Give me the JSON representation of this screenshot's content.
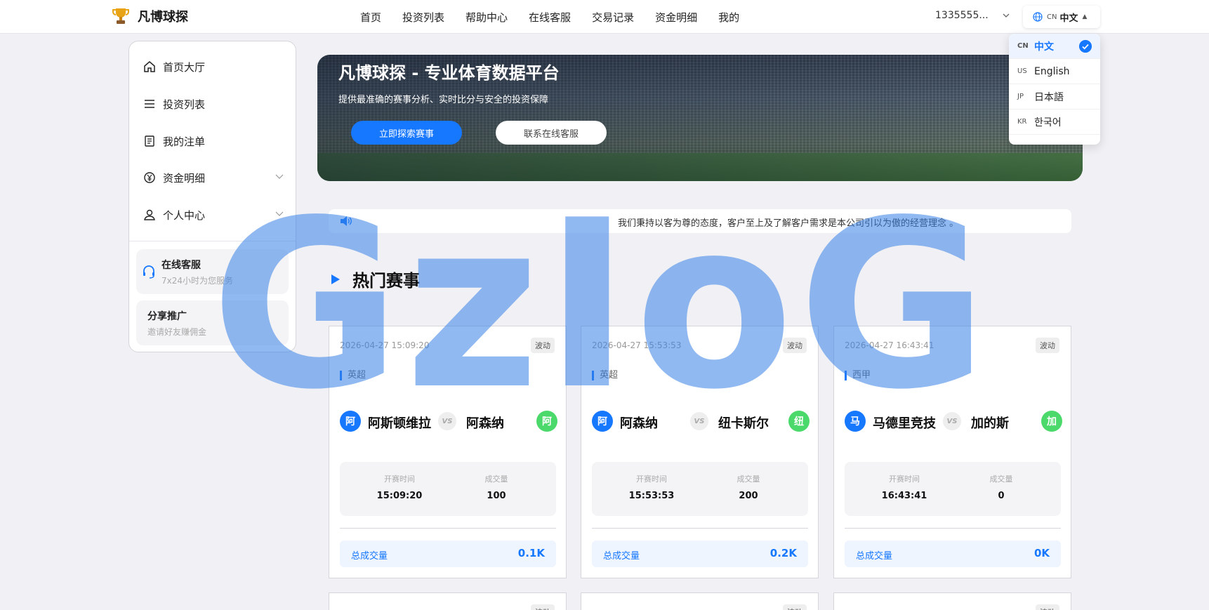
{
  "header": {
    "brand_name": "凡博球探",
    "nav": [
      "首页",
      "投资列表",
      "帮助中心",
      "在线客服",
      "交易记录",
      "资金明细",
      "我的"
    ],
    "account": "1335555...",
    "language": {
      "code": "CN",
      "label": "中文"
    }
  },
  "language_menu": [
    {
      "code": "CN",
      "label": "中文",
      "selected": true
    },
    {
      "code": "US",
      "label": "English",
      "selected": false
    },
    {
      "code": "JP",
      "label": "日本語",
      "selected": false
    },
    {
      "code": "KR",
      "label": "한국어",
      "selected": false
    }
  ],
  "sidebar": {
    "items": [
      {
        "label": "首页大厅",
        "icon": "home-icon"
      },
      {
        "label": "投资列表",
        "icon": "list-icon"
      },
      {
        "label": "我的注单",
        "icon": "document-icon"
      },
      {
        "label": "资金明细",
        "icon": "yen-coin-icon",
        "expandable": true
      },
      {
        "label": "个人中心",
        "icon": "user-icon",
        "expandable": true
      }
    ],
    "support": {
      "title": "在线客服",
      "subtitle": "7x24小时为您服务"
    },
    "share": {
      "title": "分享推广",
      "subtitle": "邀请好友赚佣金"
    }
  },
  "banner": {
    "title": "凡博球探 - 专业体育数据平台",
    "subtitle": "提供最准确的赛事分析、实时比分与安全的投资保障",
    "primary_button": "立即探索赛事",
    "secondary_button": "联系在线客服"
  },
  "notice": "我们秉持以客为尊的态度，客户至上及了解客户需求是本公司引以为傲的经营理念 。",
  "section_title": "热门赛事",
  "labels": {
    "status": "波动",
    "vs": "VS",
    "start_time": "开赛时间",
    "volume": "成交量",
    "total_volume": "总成交量"
  },
  "matches": [
    {
      "datetime": "2026-04-27 15:09:20",
      "league": "英超",
      "home": "阿斯顿维拉",
      "home_initial": "阿",
      "away": "阿森纳",
      "away_initial": "阿",
      "start_time": "15:09:20",
      "volume": "100",
      "total": "0.1K"
    },
    {
      "datetime": "2026-04-27 15:53:53",
      "league": "英超",
      "home": "阿森纳",
      "home_initial": "阿",
      "away": "纽卡斯尔",
      "away_initial": "纽",
      "start_time": "15:53:53",
      "volume": "200",
      "total": "0.2K"
    },
    {
      "datetime": "2026-04-27 16:43:41",
      "league": "西甲",
      "home": "马德里竞技",
      "home_initial": "马",
      "away": "加的斯",
      "away_initial": "加",
      "start_time": "16:43:41",
      "volume": "0",
      "total": "0K"
    }
  ],
  "watermark": "GzIoG",
  "colors": {
    "accent": "#1677ff",
    "away_logo": "#4cd96b",
    "watermark": "#3680e6"
  }
}
